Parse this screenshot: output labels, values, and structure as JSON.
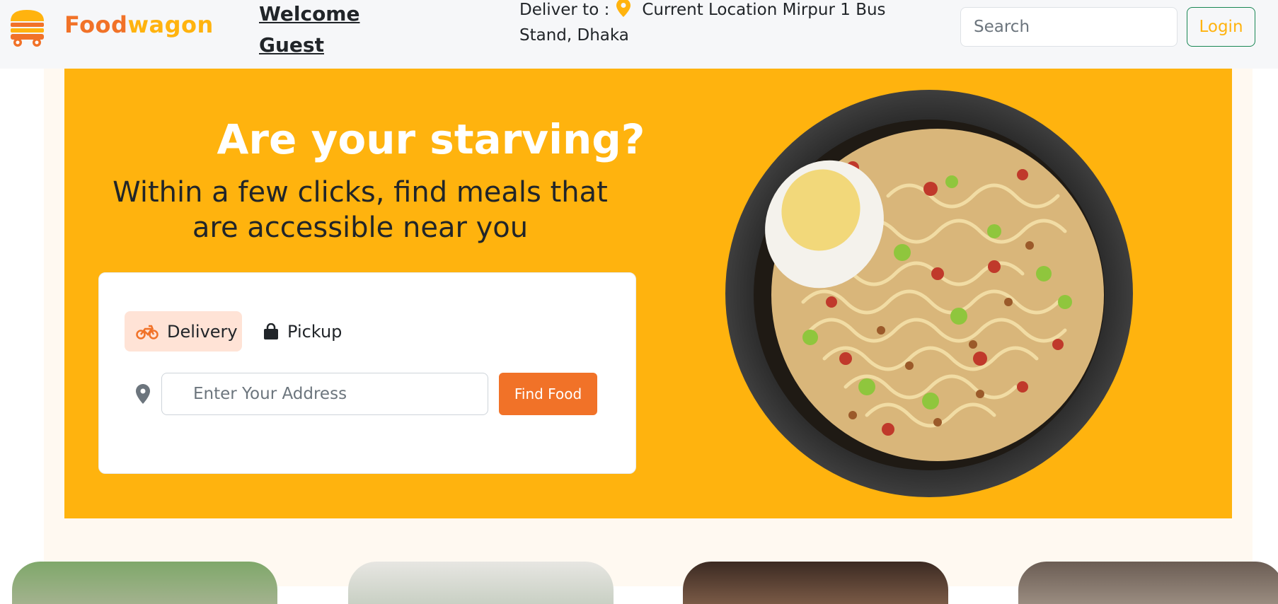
{
  "navbar": {
    "brand": "Foodwagon",
    "brand_main": "Food",
    "brand_accent": "wagon",
    "welcome": "Welcome Guest",
    "deliver_label": "Deliver to :",
    "location": "Current Location Mirpur 1 Bus Stand, Dhaka",
    "search_placeholder": "Search",
    "login_label": "Login"
  },
  "hero": {
    "headline": "Are your starving?",
    "subheadline": "Within a few clicks, find meals that are accessible near you",
    "tabs": [
      {
        "label": "Delivery",
        "icon": "motorbike-icon",
        "active": true
      },
      {
        "label": "Pickup",
        "icon": "shopping-bag-icon",
        "active": false
      }
    ],
    "address_placeholder": "Enter Your Address",
    "find_button": "Find Food"
  },
  "colors": {
    "brand_orange": "#f17228",
    "brand_yellow": "#ffb30e",
    "hero_bg": "#ffb30e",
    "active_tab_bg": "#ffe3d6",
    "login_border": "#198754"
  }
}
